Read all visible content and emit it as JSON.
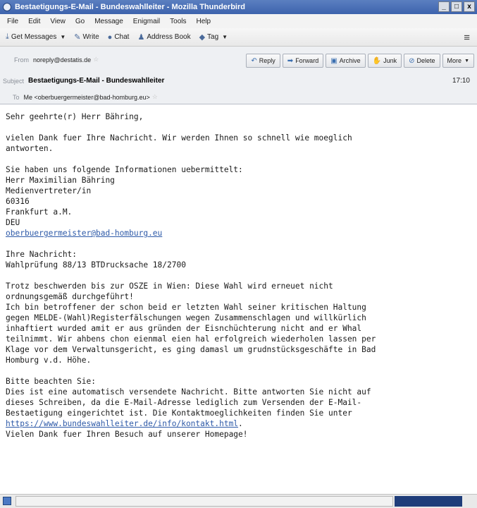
{
  "window": {
    "title": "Bestaetigungs-E-Mail - Bundeswahlleiter - Mozilla Thunderbird",
    "minimize": "_",
    "maximize": "□",
    "close": "x"
  },
  "menu": [
    "File",
    "Edit",
    "View",
    "Go",
    "Message",
    "Enigmail",
    "Tools",
    "Help"
  ],
  "toolbar": {
    "get_messages": "Get Messages",
    "write": "Write",
    "chat": "Chat",
    "address_book": "Address Book",
    "tag": "Tag"
  },
  "header": {
    "from_label": "From",
    "from_value": "noreply@destatis.de",
    "subject_label": "Subject",
    "subject_value": "Bestaetigungs-E-Mail - Bundeswahlleiter",
    "to_label": "To",
    "to_value": "Me <oberbuergermeister@bad-homburg.eu>",
    "time": "17:10",
    "actions": {
      "reply": "Reply",
      "forward": "Forward",
      "archive": "Archive",
      "junk": "Junk",
      "delete": "Delete",
      "more": "More"
    }
  },
  "body": {
    "greeting": "Sehr geehrte(r) Herr Bähring,",
    "thanks_1": "vielen Dank fuer Ihre Nachricht. Wir werden Ihnen so schnell wie moeglich",
    "thanks_2": "antworten.",
    "info_intro": "Sie haben uns folgende Informationen uebermittelt:",
    "info_name": "Herr Maximilian Bähring",
    "info_role": "Medienvertreter/in",
    "info_zip": "60316",
    "info_city": "Frankfurt a.M.",
    "info_country": "DEU",
    "info_email": "oberbuergermeister@bad-homburg.eu",
    "msg_label": "Ihre Nachricht:",
    "msg_subject": "Wahlprüfung 88/13 BTDrucksache 18/2700",
    "msg_1": "Trotz beschwerden bis zur OSZE in Wien: Diese Wahl wird erneuet nicht",
    "msg_2": "ordnungsgemäß durchgeführt!",
    "msg_3": "Ich bin betroffener der schon beid er letzten Wahl seiner kritischen Haltung",
    "msg_4": "gegen MELDE-(Wahl)Registerfälschungen wegen Zusammenschlagen und willkürlich",
    "msg_5": "inhaftiert wurded amit er aus gründen der Eisnchüchterung nicht and er Whal",
    "msg_6": "teilnimmt. Wir ahbens chon eienmal eien hal erfolgreich wiederholen lassen per",
    "msg_7": "Klage vor dem Verwaltunsgericht, es ging damasl um grudnstücksgeschäfte in Bad",
    "msg_8": "Homburg v.d. Höhe.",
    "note_label": "Bitte beachten Sie:",
    "note_1": "Dies ist eine automatisch versendete Nachricht. Bitte antworten Sie nicht auf",
    "note_2": "dieses Schreiben, da die E-Mail-Adresse lediglich zum Versenden der E-Mail-",
    "note_3": "Bestaetigung eingerichtet ist. Die Kontaktmoeglichkeiten finden Sie unter",
    "note_link": "https://www.bundeswahlleiter.de/info/kontakt.html",
    "note_link_suffix": ".",
    "closing": "Vielen Dank fuer Ihren Besuch auf unserer Homepage!"
  }
}
